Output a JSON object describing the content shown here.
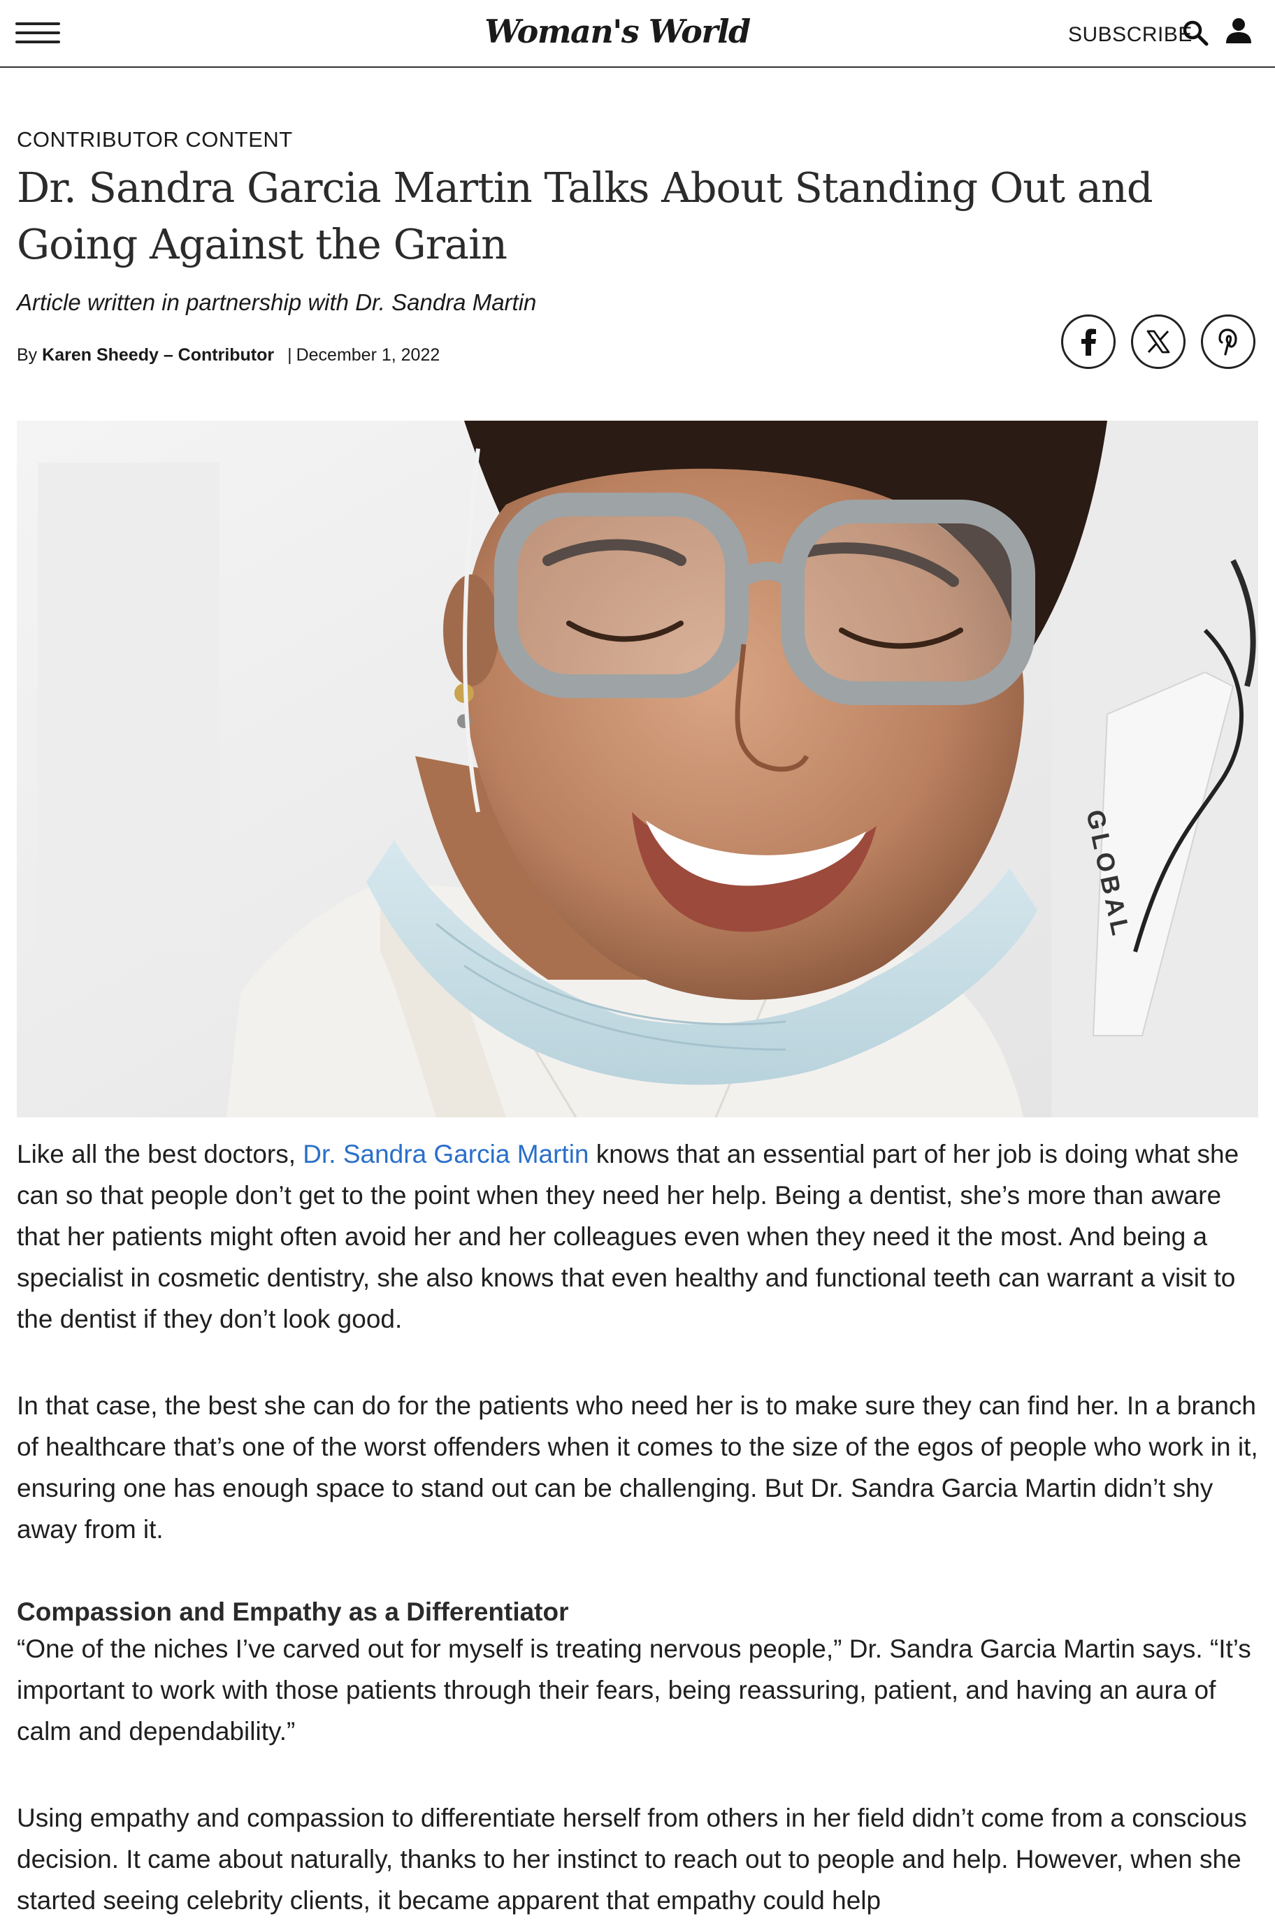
{
  "header": {
    "logo": "Woman's World",
    "subscribe_label": "SUBSCRIBE"
  },
  "article": {
    "kicker": "CONTRIBUTOR CONTENT",
    "title": "Dr. Sandra Garcia Martin Talks About Standing Out and Going Against the Grain",
    "partnership": "Article written in partnership with Dr. Sandra Martin",
    "byline_prefix": "By",
    "author": "Karen Sheedy – Contributor",
    "date": "December 1, 2022",
    "image_text": "GLOBAL",
    "p1_before_link": "Like all the best doctors, ",
    "p1_link": "Dr. Sandra Garcia Martin",
    "p1_after_link": " knows that an essential part of her job is doing what she can so that people don’t get to the point when they need her help. Being a dentist, she’s more than aware that her patients might often avoid her and her colleagues even when they need it the most. And being a specialist in cosmetic dentistry, she also knows that even healthy and functional teeth can warrant a visit to the dentist if they don’t look good.",
    "p2": "In that case, the best she can do for the patients who need her is to make sure they can find her. In a branch of healthcare that’s one of the worst offenders when it comes to the size of the egos of people who work in it, ensuring one has enough space to stand out can be challenging. But Dr. Sandra Garcia Martin didn’t shy away from it.",
    "subhead": "Compassion and Empathy as a Differentiator",
    "p3": "“One of the niches I’ve carved out for myself is treating nervous people,” Dr. Sandra Garcia Martin says. “It’s important to work with those patients through their fears, being reassuring, patient, and having an aura of calm and dependability.”",
    "p4": "Using empathy and compassion to differentiate herself from others in her field didn’t come from a conscious decision. It came about naturally, thanks to her instinct to reach out to people and help. However, when she started seeing celebrity clients, it became apparent that empathy could help"
  },
  "icons": {
    "menu": "hamburger-menu-icon",
    "search": "search-icon",
    "user": "user-icon",
    "facebook": "facebook-icon",
    "x": "x-icon",
    "pinterest": "pinterest-icon"
  },
  "colors": {
    "link": "#2a6fc9",
    "text": "#1f1f1f",
    "border": "#333333"
  }
}
